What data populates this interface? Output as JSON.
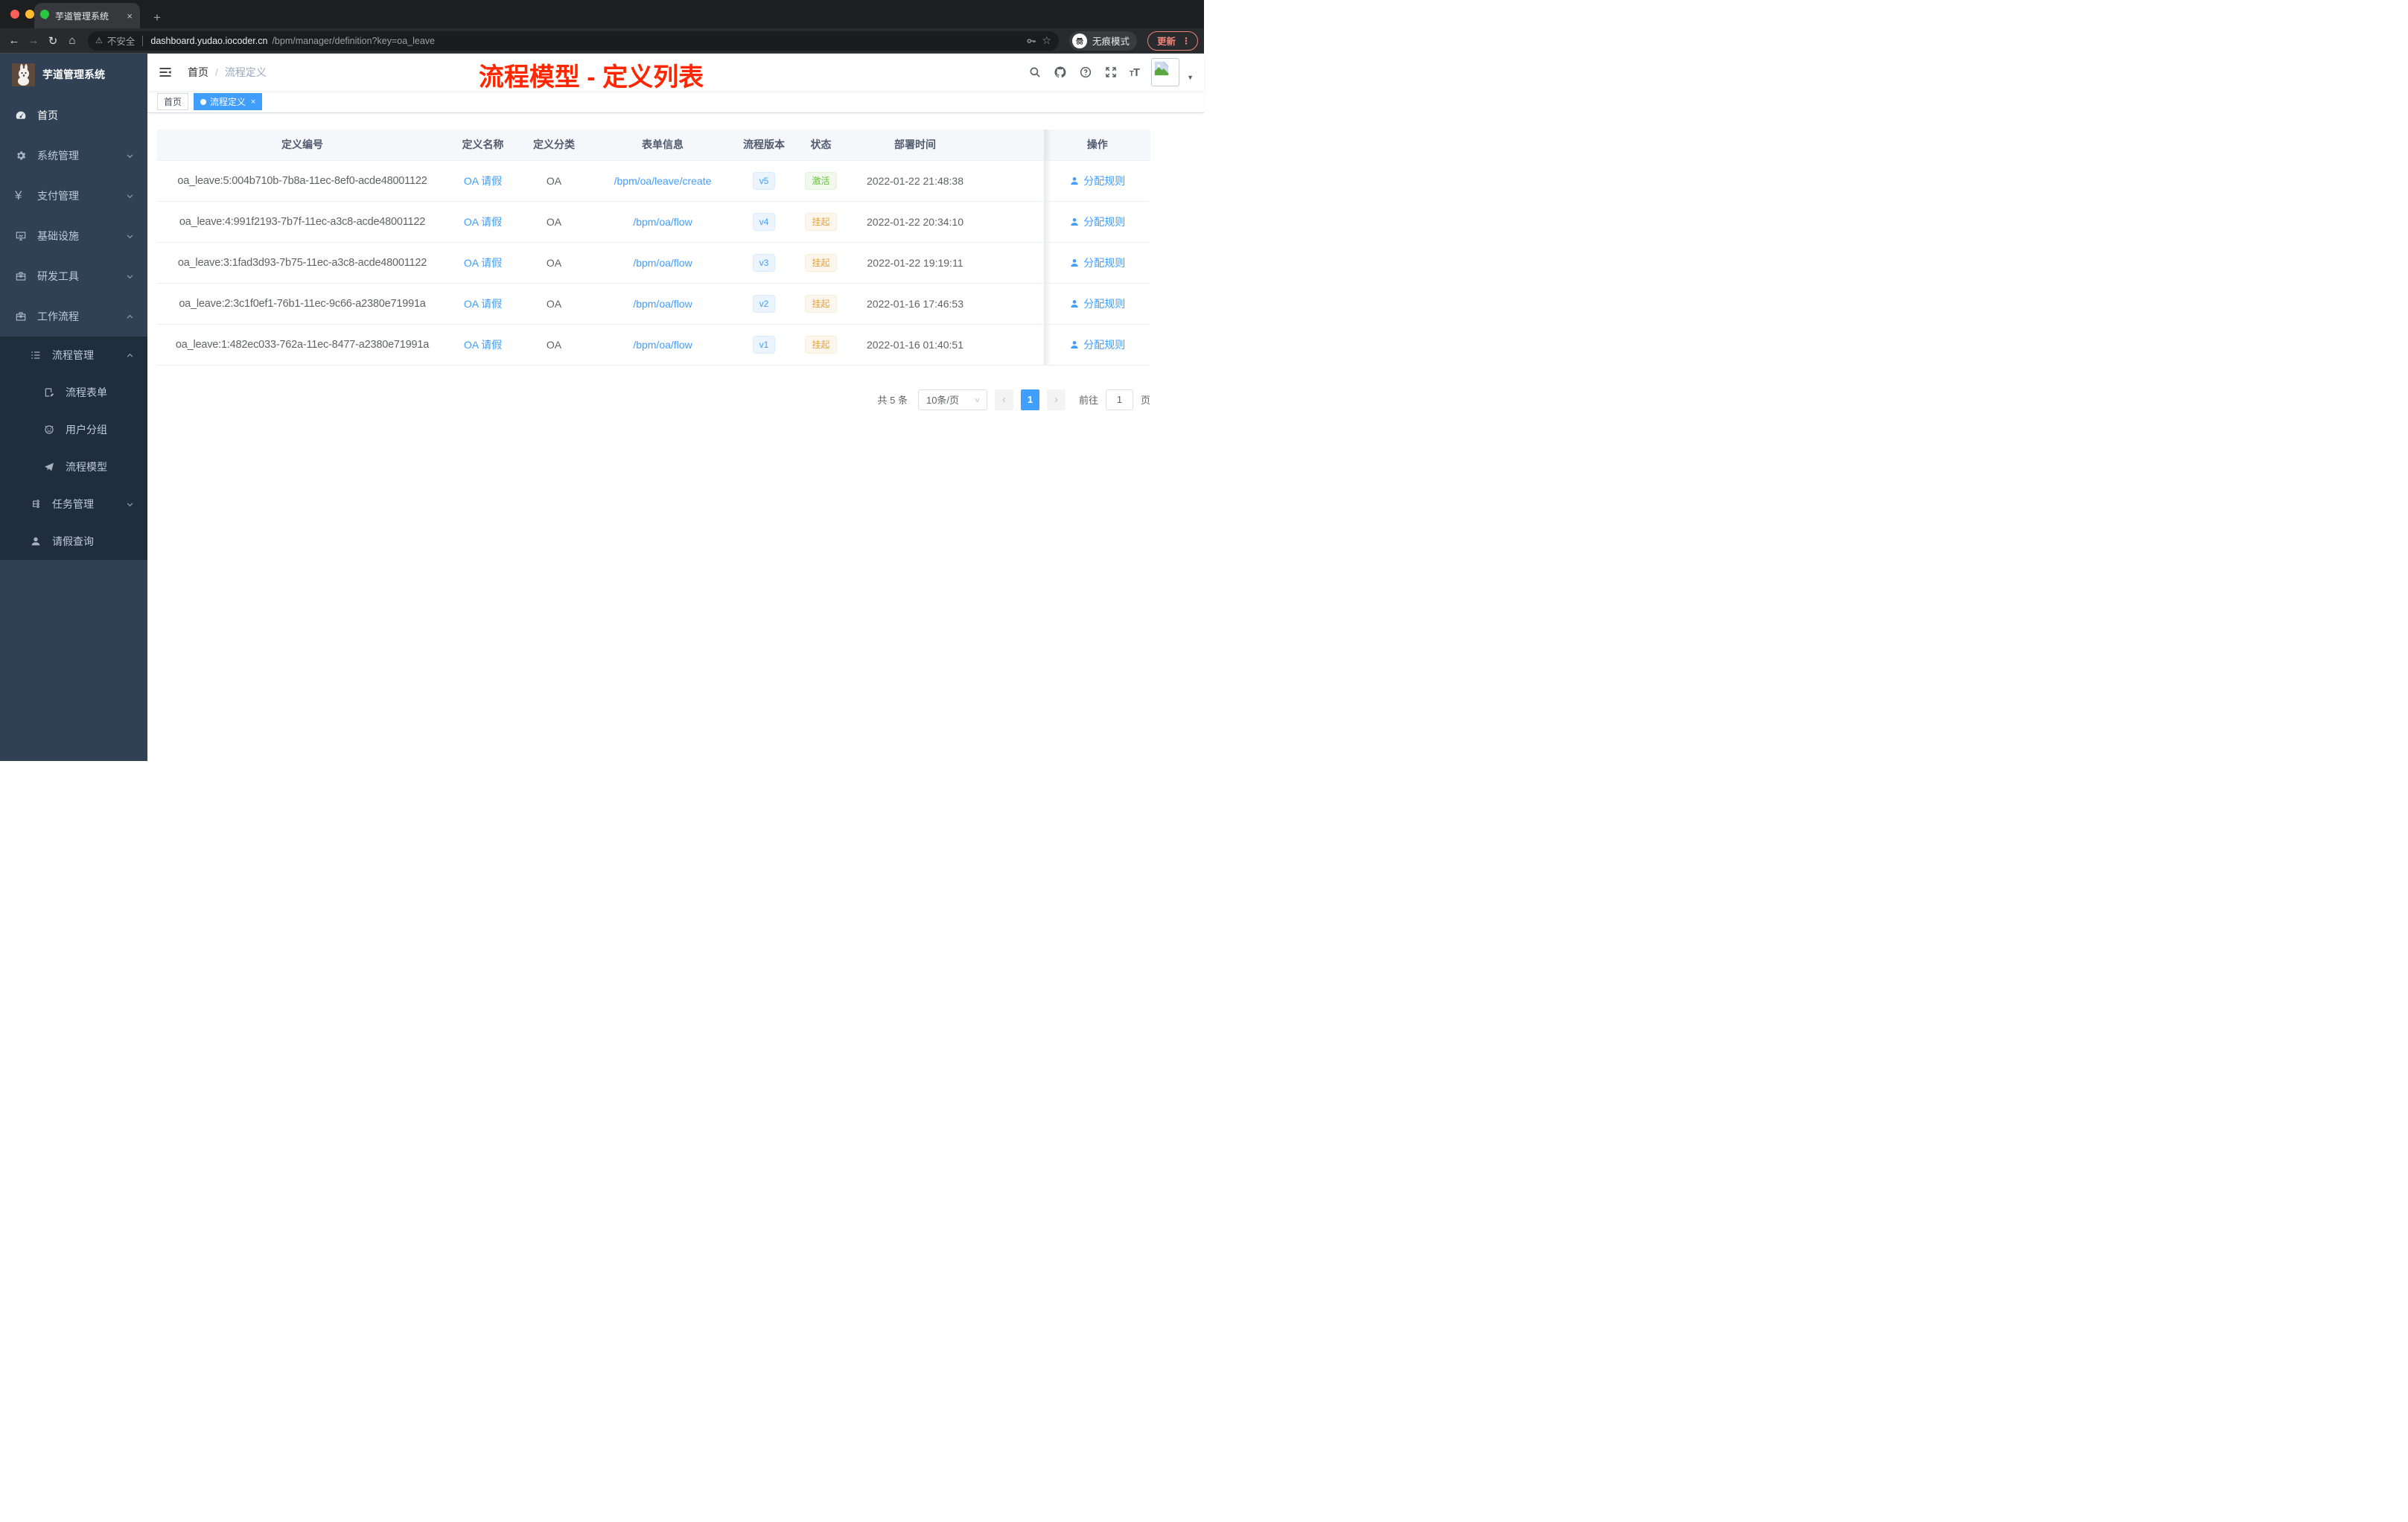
{
  "browser": {
    "tab": {
      "title": "芋道管理系统",
      "close_icon": "×",
      "new_tab_icon": "+"
    },
    "toolbar": {
      "back_icon": "←",
      "forward_icon": "→",
      "reload_icon": "↻",
      "home_icon": "⌂",
      "warning_icon": "⚠",
      "security_label": "不安全",
      "url_host": "dashboard.yudao.iocoder.cn",
      "url_path": "/bpm/manager/definition?key=oa_leave",
      "star_icon": "☆",
      "incognito_label": "无痕模式",
      "update_label": "更新",
      "menu_dots_icon": "⋮"
    }
  },
  "sidebar": {
    "logo_title": "芋道管理系统",
    "menu": [
      {
        "name": "home",
        "label": "首页",
        "icon": "dashboard",
        "level": 1,
        "expandable": false,
        "expanded": false,
        "dark": false,
        "active": true
      },
      {
        "name": "system",
        "label": "系统管理",
        "icon": "gear",
        "level": 1,
        "expandable": true,
        "expanded": false,
        "dark": false,
        "active": false
      },
      {
        "name": "payment",
        "label": "支付管理",
        "icon": "yen",
        "level": 1,
        "expandable": true,
        "expanded": false,
        "dark": false,
        "active": false
      },
      {
        "name": "infra",
        "label": "基础设施",
        "icon": "monitor",
        "level": 1,
        "expandable": true,
        "expanded": false,
        "dark": false,
        "active": false
      },
      {
        "name": "dev-tools",
        "label": "研发工具",
        "icon": "toolbox",
        "level": 1,
        "expandable": true,
        "expanded": false,
        "dark": false,
        "active": false
      },
      {
        "name": "workflow",
        "label": "工作流程",
        "icon": "toolbox",
        "level": 1,
        "expandable": true,
        "expanded": true,
        "dark": false,
        "active": false
      },
      {
        "name": "process-manage",
        "label": "流程管理",
        "icon": "list-tree",
        "level": 2,
        "expandable": true,
        "expanded": true,
        "dark": true,
        "active": false
      },
      {
        "name": "process-form",
        "label": "流程表单",
        "icon": "form",
        "level": 3,
        "expandable": false,
        "expanded": false,
        "dark": true,
        "active": false
      },
      {
        "name": "user-group",
        "label": "用户分组",
        "icon": "user-group",
        "level": 3,
        "expandable": false,
        "expanded": false,
        "dark": true,
        "active": false
      },
      {
        "name": "process-model",
        "label": "流程模型",
        "icon": "paper-plane",
        "level": 3,
        "expandable": false,
        "expanded": false,
        "dark": true,
        "active": false
      },
      {
        "name": "task-manage",
        "label": "任务管理",
        "icon": "tree",
        "level": 2,
        "expandable": true,
        "expanded": false,
        "dark": true,
        "active": false
      },
      {
        "name": "leave-query",
        "label": "请假查询",
        "icon": "user",
        "level": 2,
        "expandable": false,
        "expanded": false,
        "dark": true,
        "active": false
      }
    ]
  },
  "navbar": {
    "breadcrumb": {
      "items": [
        "首页",
        "流程定义"
      ],
      "separator": "/"
    },
    "annotation": "流程模型 - 定义列表",
    "icons": [
      "search",
      "github",
      "help",
      "fullscreen",
      "font-size"
    ],
    "caret_icon": "▼"
  },
  "tags": [
    {
      "label": "首页",
      "active": false,
      "closable": false
    },
    {
      "label": "流程定义",
      "active": true,
      "closable": true,
      "close_icon": "×"
    }
  ],
  "table": {
    "headers": [
      "定义编号",
      "定义名称",
      "定义分类",
      "表单信息",
      "流程版本",
      "状态",
      "部署时间",
      "操作"
    ],
    "rows": [
      {
        "id": "oa_leave:5:004b710b-7b8a-11ec-8ef0-acde48001122",
        "name": "OA 请假",
        "category": "OA",
        "form": "/bpm/oa/leave/create",
        "version": "v5",
        "status": "激活",
        "status_type": "success",
        "deployed": "2022-01-22 21:48:38",
        "action": "分配规则"
      },
      {
        "id": "oa_leave:4:991f2193-7b7f-11ec-a3c8-acde48001122",
        "name": "OA 请假",
        "category": "OA",
        "form": "/bpm/oa/flow",
        "version": "v4",
        "status": "挂起",
        "status_type": "warning",
        "deployed": "2022-01-22 20:34:10",
        "action": "分配规则"
      },
      {
        "id": "oa_leave:3:1fad3d93-7b75-11ec-a3c8-acde48001122",
        "name": "OA 请假",
        "category": "OA",
        "form": "/bpm/oa/flow",
        "version": "v3",
        "status": "挂起",
        "status_type": "warning",
        "deployed": "2022-01-22 19:19:11",
        "action": "分配规则"
      },
      {
        "id": "oa_leave:2:3c1f0ef1-76b1-11ec-9c66-a2380e71991a",
        "name": "OA 请假",
        "category": "OA",
        "form": "/bpm/oa/flow",
        "version": "v2",
        "status": "挂起",
        "status_type": "warning",
        "deployed": "2022-01-16 17:46:53",
        "action": "分配规则"
      },
      {
        "id": "oa_leave:1:482ec033-762a-11ec-8477-a2380e71991a",
        "name": "OA 请假",
        "category": "OA",
        "form": "/bpm/oa/flow",
        "version": "v1",
        "status": "挂起",
        "status_type": "warning",
        "deployed": "2022-01-16 01:40:51",
        "action": "分配规则"
      }
    ]
  },
  "pagination": {
    "total_label": "共 5 条",
    "page_size_label": "10条/页",
    "prev_icon": "‹",
    "next_icon": "›",
    "current_page": "1",
    "goto_label": "前往",
    "goto_value": "1",
    "page_unit_label": "页"
  },
  "colors": {
    "accent": "#409eff",
    "annotation_red": "#ff2600",
    "success_green": "#67c23a",
    "warning_orange": "#e6a23c",
    "sidebar_bg": "#304156",
    "sidebar_submenu_bg": "#1f2d3d"
  }
}
